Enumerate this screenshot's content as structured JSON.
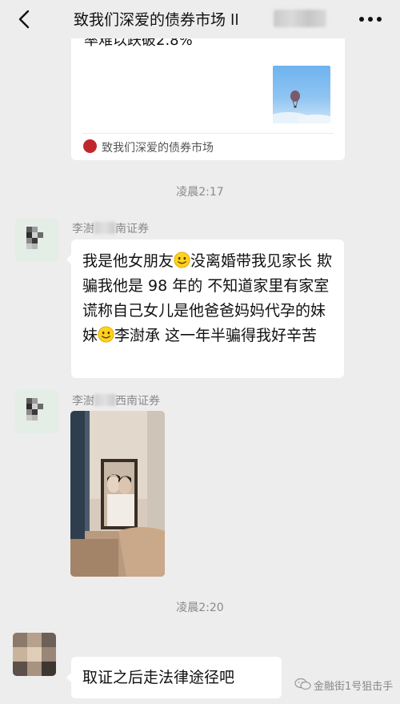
{
  "header": {
    "back_icon": "chevron-left-icon",
    "title": "致我们深爱的债券市场 ll",
    "more_icon": "more-dots-icon"
  },
  "article": {
    "cut_text": "率难以跌破2.8%",
    "source_name": "致我们深爱的债券市场",
    "thumbnail": "hot-air-balloon-sky-image"
  },
  "messages": [
    {
      "type": "timestamp",
      "text": "凌晨2:17"
    },
    {
      "type": "text",
      "sender_pre": "李澍",
      "sender_post": "南证券",
      "segments": [
        "我是他女朋友",
        "没离婚带我见家长 欺骗我他是 98 年的 不知道家里有家室 谎称自己女儿是他爸爸妈妈代孕的妹妹",
        "李澍承 这一年半骗得我好辛苦"
      ],
      "emoji": "smiling-face-emoji"
    },
    {
      "type": "image",
      "sender_pre": "李澍",
      "sender_post": "西南证券",
      "image": "bedroom-photo-with-framed-couple-portrait"
    },
    {
      "type": "timestamp",
      "text": "凌晨2:20"
    },
    {
      "type": "text",
      "text": "取证之后走法律途径吧"
    }
  ],
  "watermark": {
    "text": "金融街1号狙击手",
    "icon": "wechat-logo-icon"
  },
  "colors": {
    "background": "#ededed",
    "bubble": "#ffffff",
    "meta_text": "#8a8a8a",
    "source_logo": "#c0272d"
  }
}
